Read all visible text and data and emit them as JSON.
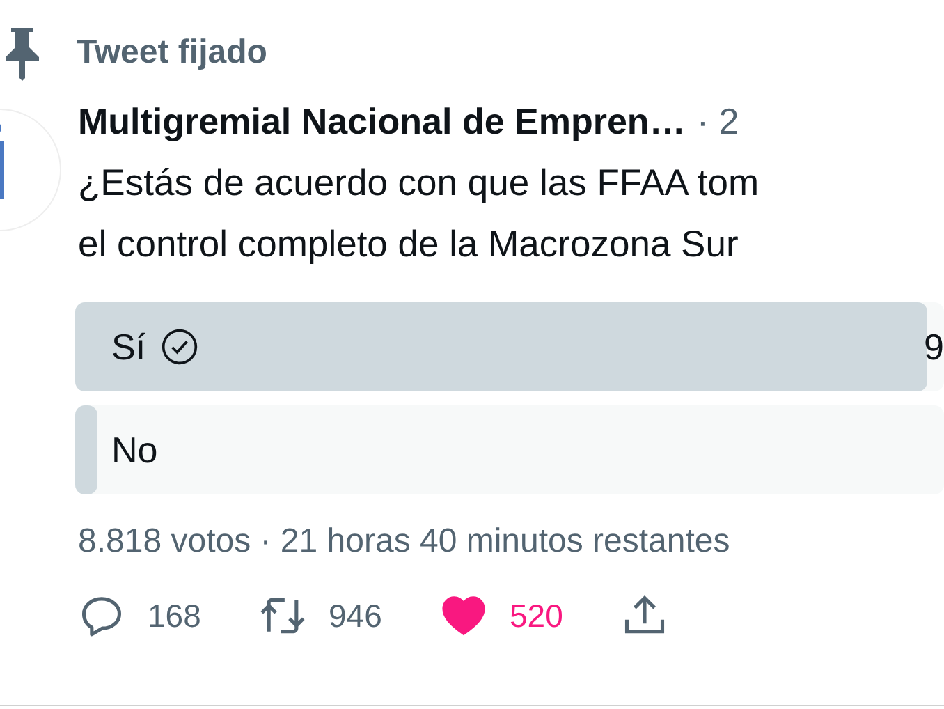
{
  "pinned": {
    "label": "Tweet fijado"
  },
  "tweet": {
    "author": "Multigremial Nacional de Empren…",
    "time": "· 2",
    "text_lines": [
      "¿Estás de acuerdo con que las FFAA tom",
      "el control completo de la Macrozona Sur"
    ]
  },
  "poll": {
    "options": [
      {
        "label": "Sí",
        "selected": true,
        "level": 0.98,
        "percent": "9"
      },
      {
        "label": "No",
        "selected": false,
        "level": 0.025
      }
    ],
    "summary": "8.818 votos · 21 horas 40 minutos restantes"
  },
  "actions": [
    {
      "kind": "reply",
      "count": "168"
    },
    {
      "kind": "retweet",
      "count": "946"
    },
    {
      "kind": "like",
      "count": "520",
      "on": true
    },
    {
      "kind": "share"
    }
  ]
}
